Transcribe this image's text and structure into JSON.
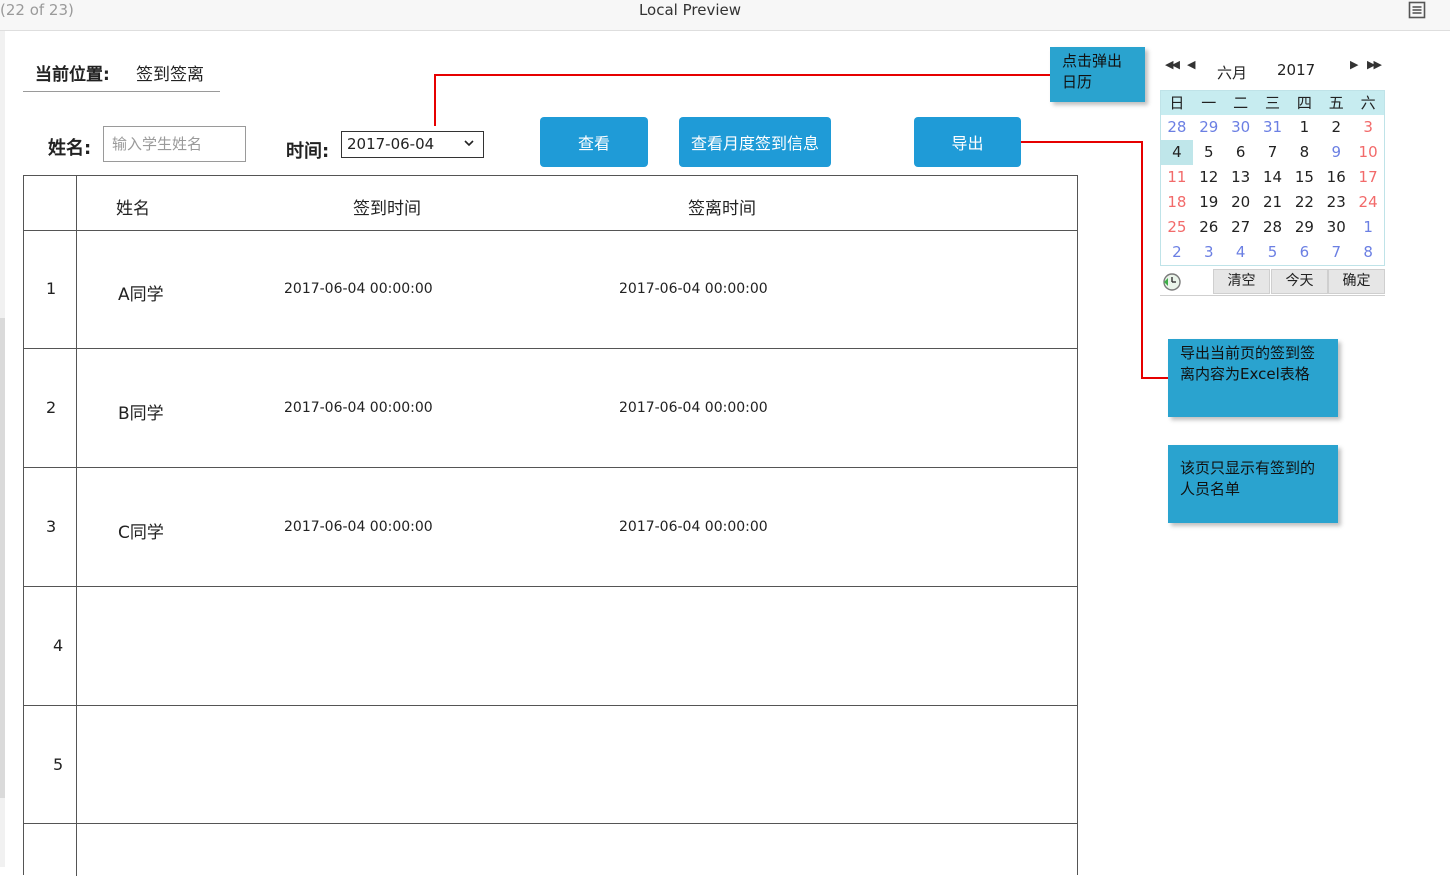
{
  "window": {
    "page_counter": "(22 of 23)",
    "title": "Local Preview",
    "menu_icon": "document-list-icon"
  },
  "location": {
    "label": "当前位置:",
    "value": "签到签离"
  },
  "filters": {
    "name_label": "姓名:",
    "name_placeholder": "输入学生姓名",
    "time_label": "时间:",
    "time_value": "2017-06-04"
  },
  "buttons": {
    "view": "查看",
    "monthly": "查看月度签到信息",
    "export": "导出"
  },
  "table": {
    "headers": [
      "姓名",
      "签到时间",
      "签离时间"
    ],
    "rows": [
      {
        "index": "1",
        "name": "A同学",
        "sign_in": "2017-06-04  00:00:00",
        "sign_out": "2017-06-04  00:00:00"
      },
      {
        "index": "2",
        "name": "B同学",
        "sign_in": "2017-06-04  00:00:00",
        "sign_out": "2017-06-04  00:00:00"
      },
      {
        "index": "3",
        "name": "C同学",
        "sign_in": "2017-06-04  00:00:00",
        "sign_out": "2017-06-04  00:00:00"
      },
      {
        "index": "4",
        "name": "",
        "sign_in": "",
        "sign_out": ""
      },
      {
        "index": "5",
        "name": "",
        "sign_in": "",
        "sign_out": ""
      }
    ]
  },
  "notes": {
    "calendar": "点击弹出日历",
    "export": "导出当前页的签到签离内容为Excel表格",
    "list": "该页只显示有签到的人员名单"
  },
  "calendar": {
    "prev_year": "◀◀",
    "prev_month": "◀",
    "month": "六月",
    "year": "2017",
    "next_month": "▶",
    "next_year": "▶▶",
    "weekdays": [
      "日",
      "一",
      "二",
      "三",
      "四",
      "五",
      "六"
    ],
    "days": [
      [
        "28",
        "29",
        "30",
        "31",
        "1",
        "2",
        "3"
      ],
      [
        "4",
        "5",
        "6",
        "7",
        "8",
        "9",
        "10"
      ],
      [
        "11",
        "12",
        "13",
        "14",
        "15",
        "16",
        "17"
      ],
      [
        "18",
        "19",
        "20",
        "21",
        "22",
        "23",
        "24"
      ],
      [
        "25",
        "26",
        "27",
        "28",
        "29",
        "30",
        "1"
      ],
      [
        "2",
        "3",
        "4",
        "5",
        "6",
        "7",
        "8"
      ]
    ],
    "selected_day": "4",
    "clear": "清空",
    "today": "今天",
    "confirm": "确定"
  },
  "colors": {
    "button": "#1f9bd7",
    "note": "#2aa3cf",
    "connector": "#e60000",
    "calendar_header": "#c7ecf0",
    "other_month": "#6b7fe3",
    "weekend": "#f26a6a"
  }
}
